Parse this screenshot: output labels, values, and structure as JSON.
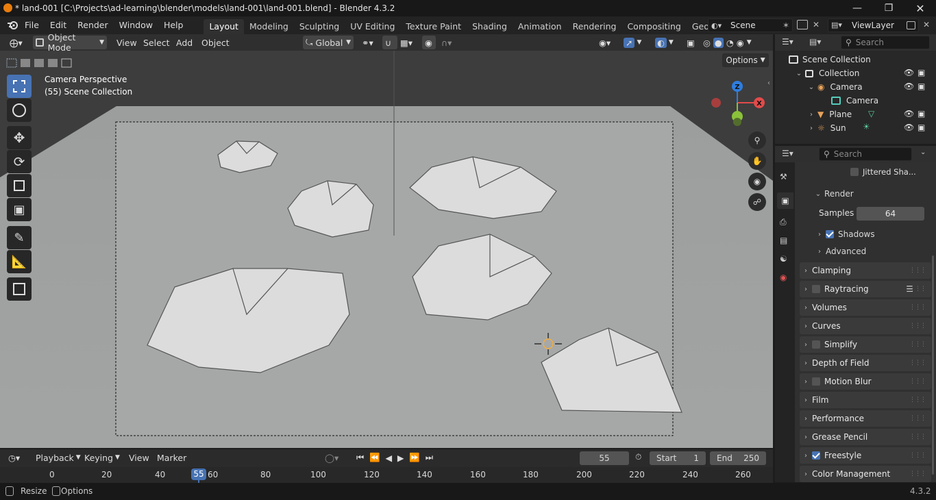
{
  "title": "* land-001 [C:\\Projects\\ad-learning\\blender\\models\\land-001\\land-001.blend] - Blender 4.3.2",
  "menus": [
    "File",
    "Edit",
    "Render",
    "Window",
    "Help"
  ],
  "workspaces": [
    "Layout",
    "Modeling",
    "Sculpting",
    "UV Editing",
    "Texture Paint",
    "Shading",
    "Animation",
    "Rendering",
    "Compositing",
    "Geometry Node"
  ],
  "scene": "Scene",
  "view_layer": "ViewLayer",
  "header": {
    "mode": "Object Mode",
    "view": "View",
    "select": "Select",
    "add": "Add",
    "object": "Object",
    "transform": "Global",
    "search_placeholder": "Search",
    "options": "Options"
  },
  "viewport": {
    "line1": "Camera Perspective",
    "line2": "(55) Scene Collection",
    "gizmo": {
      "z": "Z",
      "x": "X"
    }
  },
  "outliner": {
    "root": "Scene Collection",
    "rows": [
      {
        "name": "Collection"
      },
      {
        "name": "Camera"
      },
      {
        "name": "Camera"
      },
      {
        "name": "Plane"
      },
      {
        "name": "Sun"
      }
    ]
  },
  "properties": {
    "search_placeholder": "Search",
    "jittered": "Jittered Sha...",
    "render_label": "Render",
    "samples_label": "Samples",
    "samples_value": "64",
    "shadows": "Shadows",
    "advanced": "Advanced",
    "panels": [
      "Clamping",
      "Raytracing",
      "Volumes",
      "Curves",
      "Simplify",
      "Depth of Field",
      "Motion Blur",
      "Film",
      "Performance",
      "Grease Pencil",
      "Freestyle",
      "Color Management"
    ]
  },
  "timeline": {
    "playback": "Playback",
    "keying": "Keying",
    "view": "View",
    "marker": "Marker",
    "current_frame": "55",
    "start_label": "Start",
    "start": "1",
    "end_label": "End",
    "end": "250",
    "ticks": [
      "0",
      "20",
      "40",
      "60",
      "80",
      "100",
      "120",
      "140",
      "160",
      "180",
      "200",
      "220",
      "240",
      "260"
    ],
    "playhead": "55"
  },
  "status": {
    "resize": "Resize",
    "options": "Options",
    "version": "4.3.2"
  },
  "colors": {
    "accent": "#4772b3",
    "gizmo_x": "#e34a4a",
    "gizmo_y": "#8bc23a",
    "gizmo_z": "#2e7de0"
  }
}
